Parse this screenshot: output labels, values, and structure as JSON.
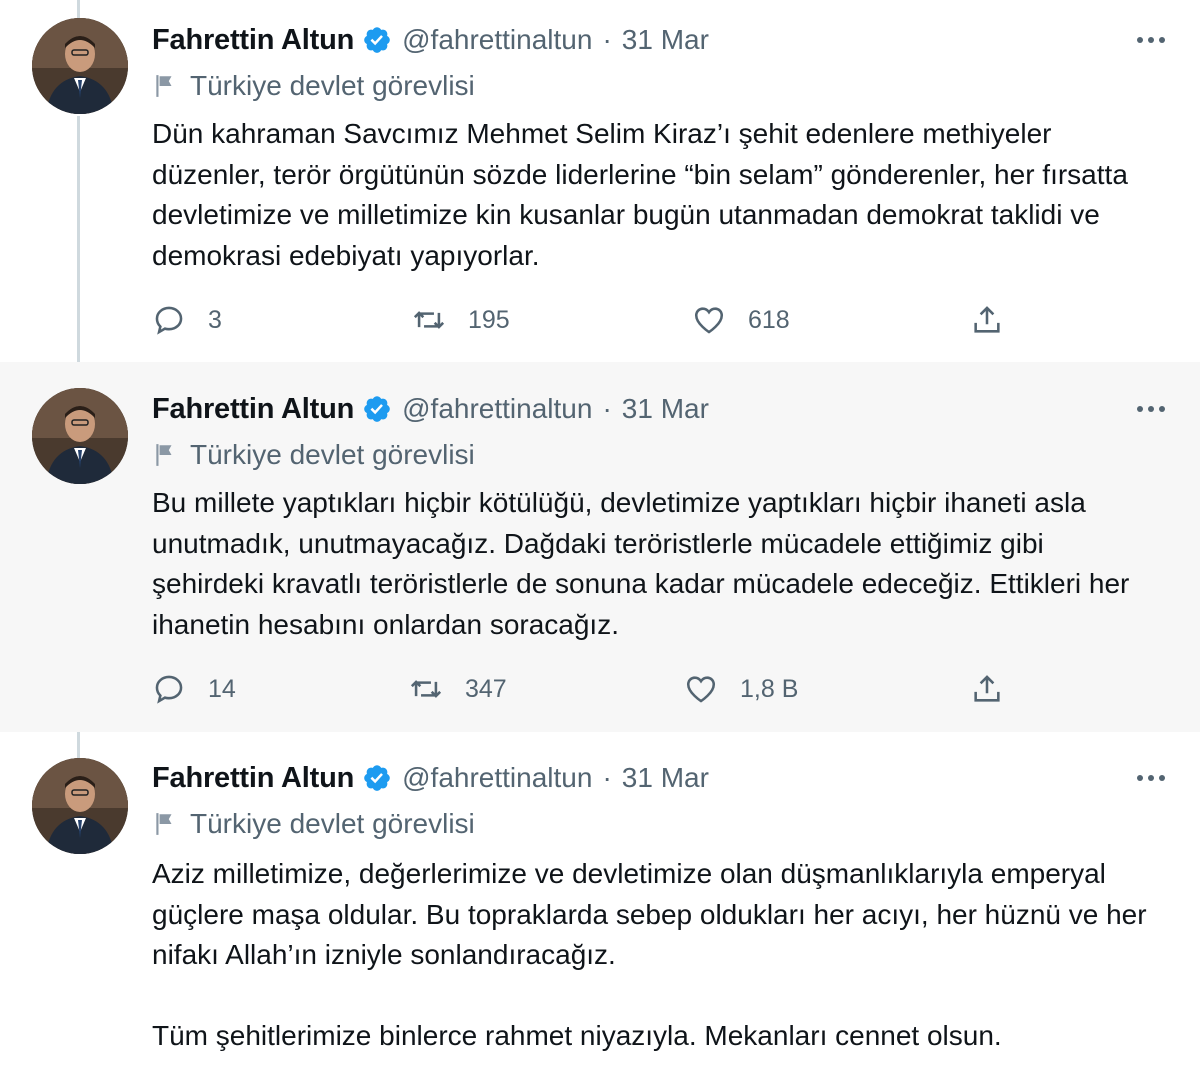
{
  "tweets": [
    {
      "author": "Fahrettin Altun",
      "handle": "@fahrettinaltun",
      "separator": "·",
      "date": "31 Mar",
      "label": "Türkiye devlet görevlisi",
      "paragraphs": [
        "Dün kahraman Savcımız Mehmet Selim Kiraz’ı şehit edenlere methiyeler düzenler, terör örgütünün sözde liderlerine “bin selam” gönderenler, her fırsatta devletimize ve milletimize kin kusanlar bugün utanmadan demokrat taklidi ve demokrasi edebiyatı yapıyorlar."
      ],
      "replies": "3",
      "retweets": "195",
      "likes": "618"
    },
    {
      "author": "Fahrettin Altun",
      "handle": "@fahrettinaltun",
      "separator": "·",
      "date": "31 Mar",
      "label": "Türkiye devlet görevlisi",
      "paragraphs": [
        "Bu millete yaptıkları hiçbir kötülüğü, devletimize yaptıkları hiçbir ihaneti asla unutmadık, unutmayacağız. Dağdaki teröristlerle mücadele ettiğimiz gibi şehirdeki kravatlı teröristlerle de sonuna kadar mücadele edeceğiz. Ettikleri her ihanetin hesabını onlardan soracağız."
      ],
      "replies": "14",
      "retweets": "347",
      "likes": "1,8 B"
    },
    {
      "author": "Fahrettin Altun",
      "handle": "@fahrettinaltun",
      "separator": "·",
      "date": "31 Mar",
      "label": "Türkiye devlet görevlisi",
      "paragraphs": [
        "Aziz milletimize, değerlerimize ve devletimize olan düşmanlıklarıyla emperyal güçlere maşa oldular. Bu topraklarda sebep oldukları her acıyı, her hüznü ve her nifakı Allah’ın izniyle sonlandıracağız.",
        "Tüm şehitlerimize binlerce rahmet niyazıyla. Mekanları cennet olsun."
      ]
    }
  ],
  "icons": {
    "verified": "verified-badge-icon",
    "more": "more-options-icon",
    "label": "flag-icon",
    "reply": "reply-icon",
    "retweet": "retweet-icon",
    "like": "heart-icon",
    "share": "share-icon"
  },
  "colors": {
    "verified_blue": "#1d9bf0",
    "secondary_text": "#536471",
    "shaded_bg": "#f7f7f7",
    "thread_line": "#cfd9de"
  }
}
